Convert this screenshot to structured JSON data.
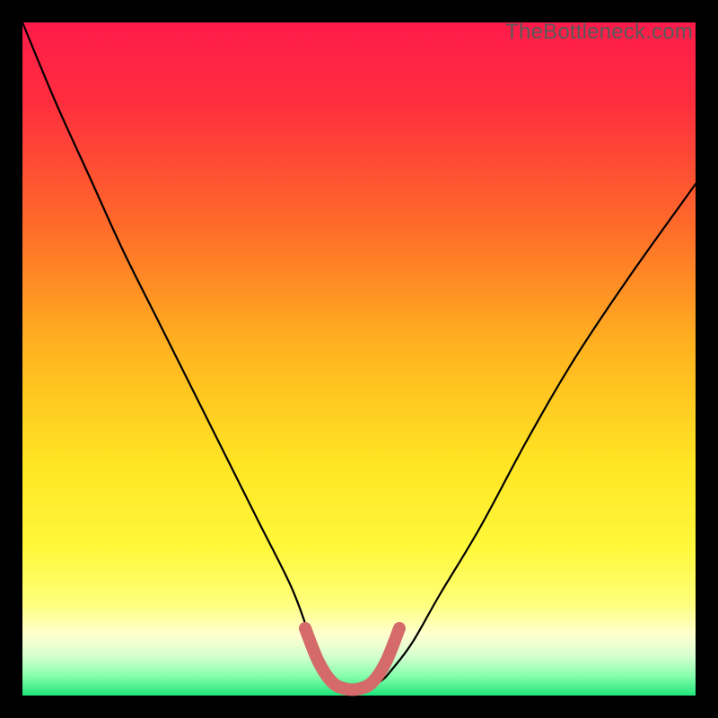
{
  "watermark": {
    "text": "TheBottleneck.com"
  },
  "colors": {
    "bg": "#000000",
    "grad_top": "#ff1b4a",
    "grad_mid_upper": "#ff5a2f",
    "grad_mid": "#ffb21f",
    "grad_mid_lower": "#fff028",
    "grad_low_yellow": "#ffff60",
    "grad_pale": "#ffffc8",
    "grad_mint": "#b8ffc8",
    "grad_green": "#22e37a",
    "curve": "#000000",
    "highlight": "#d46a6a"
  },
  "chart_data": {
    "type": "line",
    "title": "",
    "xlabel": "",
    "ylabel": "",
    "xlim": [
      0,
      100
    ],
    "ylim": [
      0,
      100
    ],
    "series": [
      {
        "name": "bottleneck-curve",
        "x": [
          0,
          5,
          10,
          15,
          20,
          25,
          30,
          35,
          40,
          43,
          45,
          47,
          50,
          53,
          55,
          58,
          62,
          68,
          75,
          82,
          90,
          100
        ],
        "y": [
          100,
          88,
          77,
          66,
          56,
          46,
          36,
          26,
          16,
          8,
          4,
          2,
          1,
          2,
          4,
          8,
          15,
          25,
          38,
          50,
          62,
          76
        ]
      },
      {
        "name": "optimal-range-highlight",
        "x": [
          42,
          44,
          46,
          48,
          50,
          52,
          54,
          56
        ],
        "y": [
          10,
          5,
          2,
          1,
          1,
          2,
          5,
          10
        ]
      }
    ],
    "annotations": []
  }
}
